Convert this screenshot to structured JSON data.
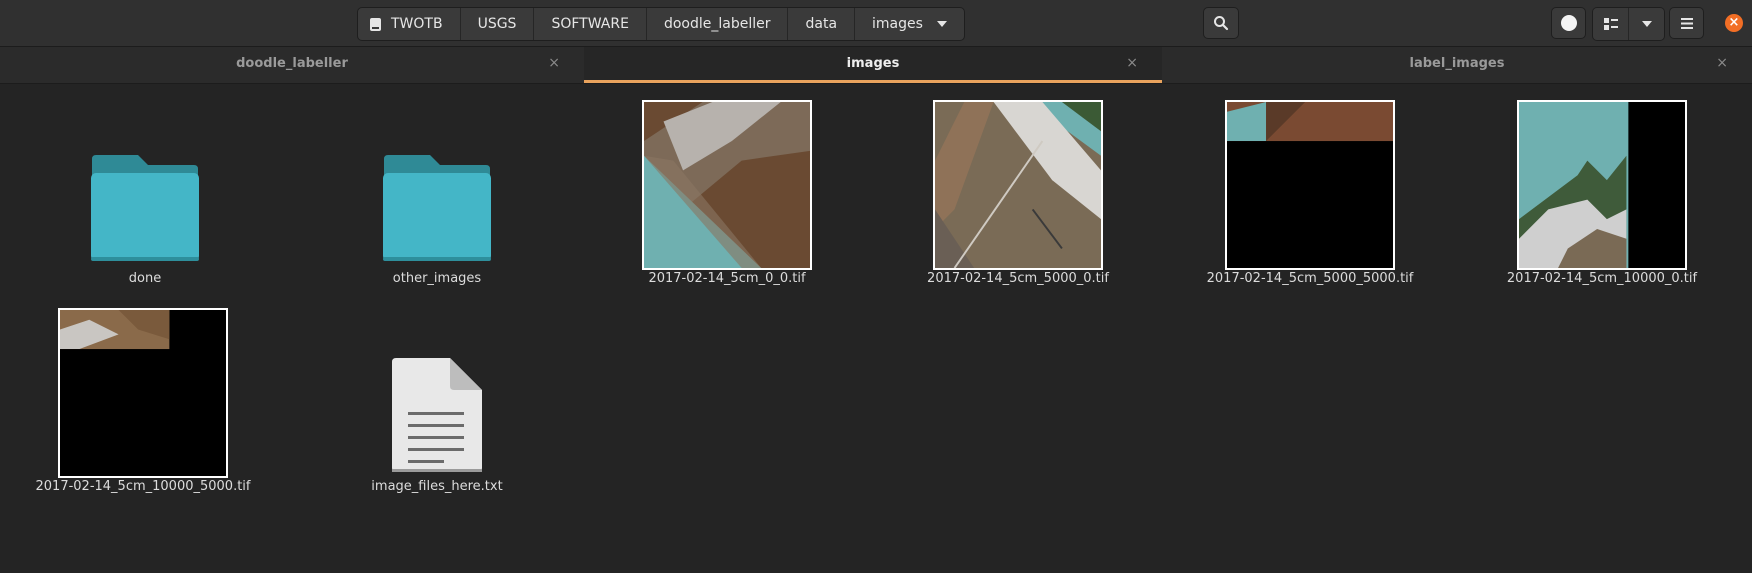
{
  "header": {
    "breadcrumbs": [
      "TWOTB",
      "USGS",
      "SOFTWARE",
      "doodle_labeller",
      "data",
      "images"
    ],
    "root_icon": "drive-icon",
    "search_icon": "search-icon",
    "view_icons": [
      "circle-icon",
      "grid-view-icon",
      "chevron-down-icon"
    ],
    "menu_icon": "hamburger-menu-icon",
    "close_glyph": "×",
    "close_color": "#f26e25"
  },
  "tabs": [
    {
      "label": "doodle_labeller",
      "close": "×",
      "active": false
    },
    {
      "label": "images",
      "close": "×",
      "active": true
    },
    {
      "label": "label_images",
      "close": "×",
      "active": false
    }
  ],
  "accent_color": "#e9a35d",
  "files": [
    {
      "name": "done",
      "kind": "folder"
    },
    {
      "name": "other_images",
      "kind": "folder"
    },
    {
      "name": "2017-02-14_5cm_0_0.tif",
      "kind": "image"
    },
    {
      "name": "2017-02-14_5cm_5000_0.tif",
      "kind": "image"
    },
    {
      "name": "2017-02-14_5cm_5000_5000.tif",
      "kind": "image"
    },
    {
      "name": "2017-02-14_5cm_10000_0.tif",
      "kind": "image"
    },
    {
      "name": "2017-02-14_5cm_10000_5000.tif",
      "kind": "image"
    },
    {
      "name": "image_files_here.txt",
      "kind": "text"
    }
  ]
}
